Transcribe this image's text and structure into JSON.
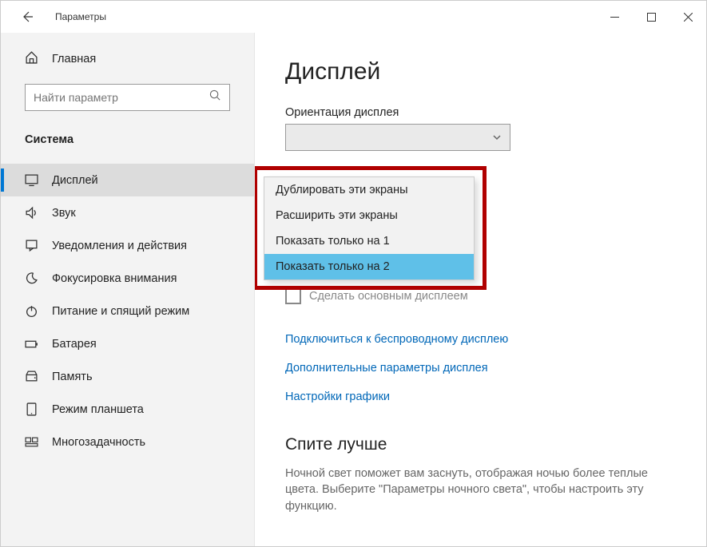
{
  "window": {
    "title": "Параметры"
  },
  "sidebar": {
    "home_label": "Главная",
    "search_placeholder": "Найти параметр",
    "section_label": "Система",
    "items": [
      {
        "label": "Дисплей"
      },
      {
        "label": "Звук"
      },
      {
        "label": "Уведомления и действия"
      },
      {
        "label": "Фокусировка внимания"
      },
      {
        "label": "Питание и спящий режим"
      },
      {
        "label": "Батарея"
      },
      {
        "label": "Память"
      },
      {
        "label": "Режим планшета"
      },
      {
        "label": "Многозадачность"
      }
    ]
  },
  "main": {
    "page_title": "Дисплей",
    "orientation_label": "Ориентация дисплея",
    "dropdown_options": [
      {
        "label": "Дублировать эти экраны"
      },
      {
        "label": "Расширить эти экраны"
      },
      {
        "label": "Показать только на 1"
      },
      {
        "label": "Показать только на 2"
      }
    ],
    "checkbox_label": "Сделать основным дисплеем",
    "link_wireless": "Подключиться к беспроводному дисплею",
    "link_advanced": "Дополнительные параметры дисплея",
    "link_graphics": "Настройки графики",
    "sleep_heading": "Спите лучше",
    "sleep_text": "Ночной свет поможет вам заснуть, отображая ночью более теплые цвета. Выберите \"Параметры ночного света\", чтобы настроить эту функцию."
  }
}
